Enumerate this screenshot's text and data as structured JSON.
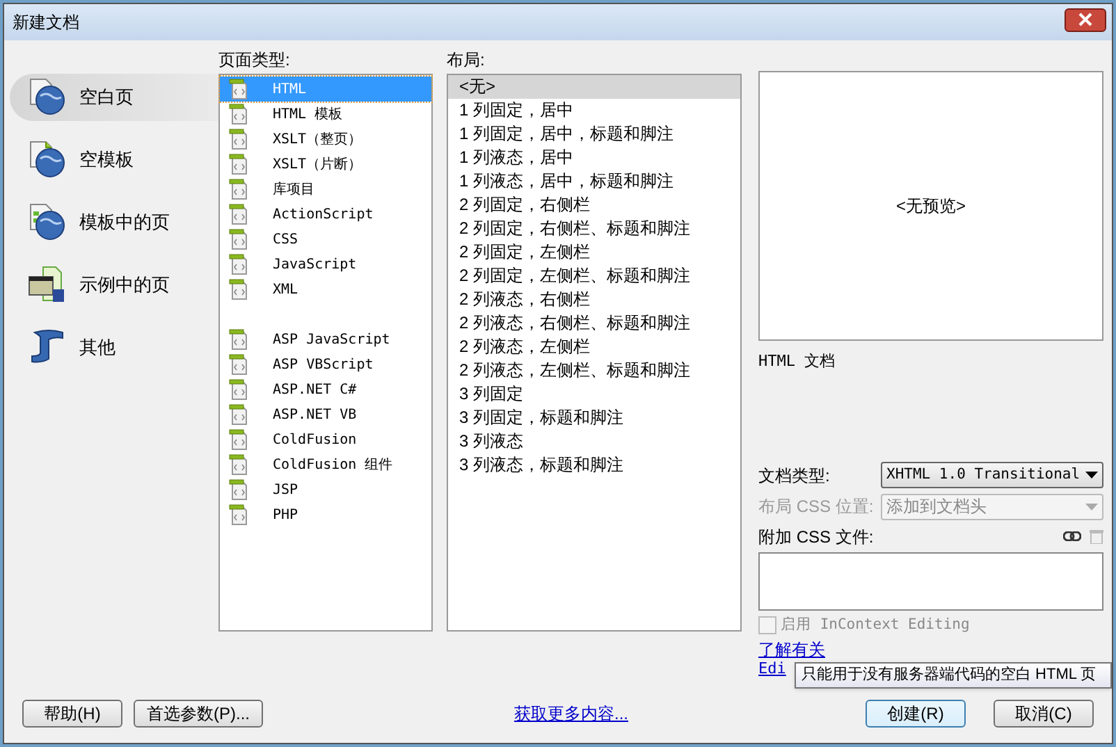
{
  "window": {
    "title": "新建文档"
  },
  "categories": [
    {
      "label": "空白页",
      "selected": true
    },
    {
      "label": "空模板",
      "selected": false
    },
    {
      "label": "模板中的页",
      "selected": false
    },
    {
      "label": "示例中的页",
      "selected": false
    },
    {
      "label": "其他",
      "selected": false
    }
  ],
  "page_types": {
    "heading": "页面类型:",
    "groups": [
      [
        {
          "label": "HTML",
          "selected": true
        },
        {
          "label": "HTML 模板",
          "selected": false
        },
        {
          "label": "XSLT（整页）",
          "selected": false
        },
        {
          "label": "XSLT（片断）",
          "selected": false
        },
        {
          "label": "库项目",
          "selected": false
        },
        {
          "label": "ActionScript",
          "selected": false
        },
        {
          "label": "CSS",
          "selected": false
        },
        {
          "label": "JavaScript",
          "selected": false
        },
        {
          "label": "XML",
          "selected": false
        }
      ],
      [
        {
          "label": "ASP JavaScript",
          "selected": false
        },
        {
          "label": "ASP VBScript",
          "selected": false
        },
        {
          "label": "ASP.NET C#",
          "selected": false
        },
        {
          "label": "ASP.NET VB",
          "selected": false
        },
        {
          "label": "ColdFusion",
          "selected": false
        },
        {
          "label": "ColdFusion 组件",
          "selected": false
        },
        {
          "label": "JSP",
          "selected": false
        },
        {
          "label": "PHP",
          "selected": false
        }
      ]
    ]
  },
  "layouts": {
    "heading": "布局:",
    "items": [
      {
        "label": "<无>",
        "selected": true
      },
      {
        "label": "1 列固定，居中",
        "selected": false
      },
      {
        "label": "1 列固定，居中，标题和脚注",
        "selected": false
      },
      {
        "label": "1 列液态，居中",
        "selected": false
      },
      {
        "label": "1 列液态，居中，标题和脚注",
        "selected": false
      },
      {
        "label": "2 列固定，右侧栏",
        "selected": false
      },
      {
        "label": "2 列固定，右侧栏、标题和脚注",
        "selected": false
      },
      {
        "label": "2 列固定，左侧栏",
        "selected": false
      },
      {
        "label": "2 列固定，左侧栏、标题和脚注",
        "selected": false
      },
      {
        "label": "2 列液态，右侧栏",
        "selected": false
      },
      {
        "label": "2 列液态，右侧栏、标题和脚注",
        "selected": false
      },
      {
        "label": "2 列液态，左侧栏",
        "selected": false
      },
      {
        "label": "2 列液态，左侧栏、标题和脚注",
        "selected": false
      },
      {
        "label": "3 列固定",
        "selected": false
      },
      {
        "label": "3 列固定，标题和脚注",
        "selected": false
      },
      {
        "label": "3 列液态",
        "selected": false
      },
      {
        "label": "3 列液态，标题和脚注",
        "selected": false
      }
    ]
  },
  "preview": {
    "text": "<无预览>",
    "description": "HTML 文档"
  },
  "doctype": {
    "label": "文档类型:",
    "value": "XHTML 1.0 Transitional",
    "disabled": false
  },
  "layout_css": {
    "label": "布局 CSS 位置:",
    "value": "添加到文档头",
    "disabled": true
  },
  "attach_css": {
    "label": "附加 CSS 文件:"
  },
  "incontext": {
    "label": "启用 InContext Editing",
    "checked": false,
    "disabled": true
  },
  "learn_link": [
    "了解有关",
    "Edi"
  ],
  "tooltip": "只能用于没有服务器端代码的空白 HTML 页",
  "footer": {
    "help": "帮助(H)",
    "preferences": "首选参数(P)...",
    "more_link": "获取更多内容...",
    "create": "创建(R)",
    "cancel": "取消(C)"
  }
}
